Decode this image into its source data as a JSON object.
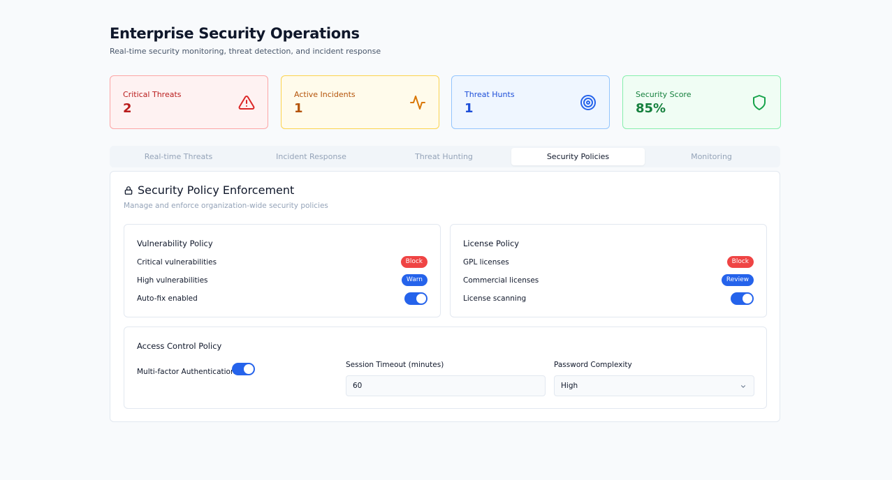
{
  "header": {
    "title": "Enterprise Security Operations",
    "subtitle": "Real-time security monitoring, threat detection, and incident response"
  },
  "stats": [
    {
      "label": "Critical Threats",
      "value": "2",
      "icon": "alert-triangle-icon",
      "color": "#b91c1c"
    },
    {
      "label": "Active Incidents",
      "value": "1",
      "icon": "activity-icon",
      "color": "#b45309"
    },
    {
      "label": "Threat Hunts",
      "value": "1",
      "icon": "target-icon",
      "color": "#1d4ed8"
    },
    {
      "label": "Security Score",
      "value": "85%",
      "icon": "shield-icon",
      "color": "#15803d"
    }
  ],
  "tabs": [
    {
      "label": "Real-time Threats",
      "active": false
    },
    {
      "label": "Incident Response",
      "active": false
    },
    {
      "label": "Threat Hunting",
      "active": false
    },
    {
      "label": "Security Policies",
      "active": true
    },
    {
      "label": "Monitoring",
      "active": false
    }
  ],
  "panel": {
    "title": "Security Policy Enforcement",
    "icon": "lock-icon",
    "description": "Manage and enforce organization-wide security policies"
  },
  "vulnerability_policy": {
    "title": "Vulnerability Policy",
    "rows": [
      {
        "label": "Critical vulnerabilities",
        "badge": "Block"
      },
      {
        "label": "High vulnerabilities",
        "badge": "Warn"
      },
      {
        "label": "Auto-fix enabled",
        "toggle": true
      }
    ]
  },
  "license_policy": {
    "title": "License Policy",
    "rows": [
      {
        "label": "GPL licenses",
        "badge": "Block"
      },
      {
        "label": "Commercial licenses",
        "badge": "Review"
      },
      {
        "label": "License scanning",
        "toggle": true
      }
    ]
  },
  "access_policy": {
    "title": "Access Control Policy",
    "mfa_label": "Multi-factor Authentication",
    "mfa_enabled": true,
    "session_timeout_label": "Session Timeout (minutes)",
    "session_timeout_value": "60",
    "password_complexity_label": "Password Complexity",
    "password_complexity_value": "High"
  },
  "colors": {
    "accent": "#2563eb",
    "danger": "#ef4444"
  }
}
